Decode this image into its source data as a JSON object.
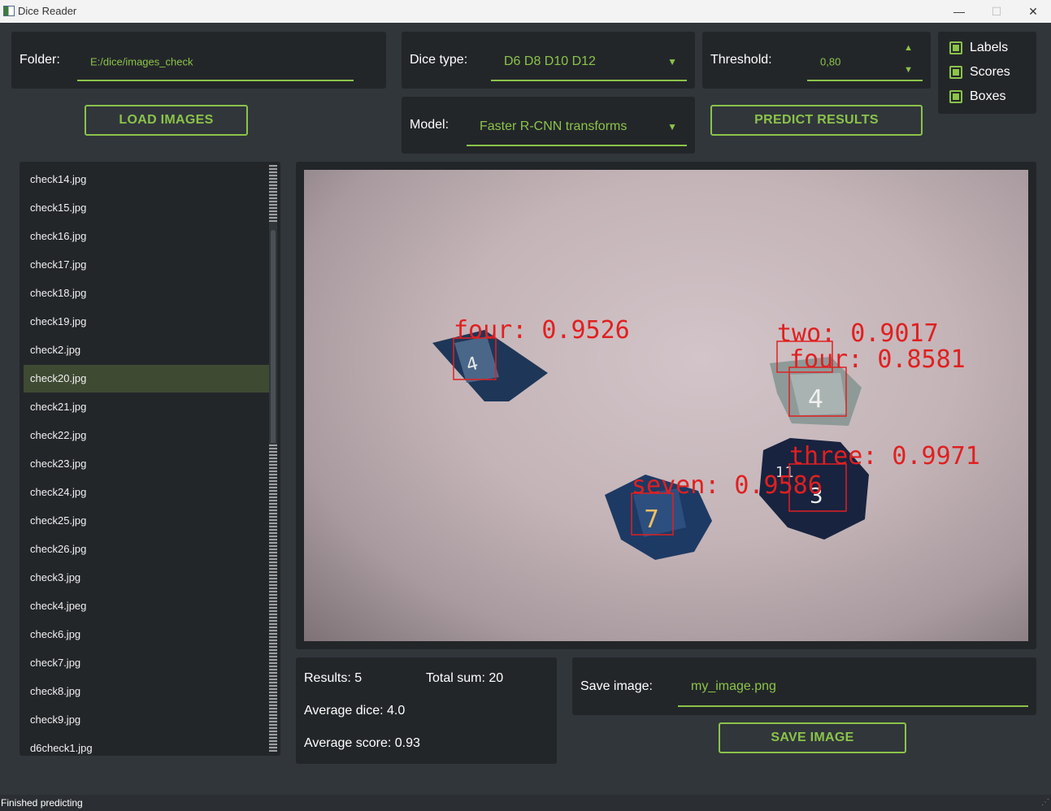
{
  "window": {
    "title": "Dice Reader",
    "minimize": "—",
    "maximize": "☐",
    "close": "✕"
  },
  "folder": {
    "label": "Folder:",
    "value": "E:/dice/images_check"
  },
  "dice_type": {
    "label": "Dice type:",
    "value": "D6 D8 D10 D12"
  },
  "threshold": {
    "label": "Threshold:",
    "value": "0,80"
  },
  "model": {
    "label": "Model:",
    "value": "Faster R-CNN transforms"
  },
  "buttons": {
    "load": "LOAD IMAGES",
    "predict": "PREDICT RESULTS",
    "save": "SAVE IMAGE"
  },
  "options": {
    "labels": "Labels",
    "scores": "Scores",
    "boxes": "Boxes"
  },
  "files": [
    "check14.jpg",
    "check15.jpg",
    "check16.jpg",
    "check17.jpg",
    "check18.jpg",
    "check19.jpg",
    "check2.jpg",
    "check20.jpg",
    "check21.jpg",
    "check22.jpg",
    "check23.jpg",
    "check24.jpg",
    "check25.jpg",
    "check26.jpg",
    "check3.jpg",
    "check4.jpeg",
    "check6.jpg",
    "check7.jpg",
    "check8.jpg",
    "check9.jpg",
    "d6check1.jpg"
  ],
  "selected_file": "check20.jpg",
  "detections": [
    {
      "label": "four: 0.9526"
    },
    {
      "label": "two: 0.9017"
    },
    {
      "label": "four: 0.8581"
    },
    {
      "label": "three: 0.9971"
    },
    {
      "label": "seven: 0.9586"
    }
  ],
  "results": {
    "count": "Results: 5",
    "total": "Total sum: 20",
    "average_dice": "Average dice: 4.0",
    "average_score": "Average score: 0.93"
  },
  "save": {
    "label": "Save image:",
    "value": "my_image.png"
  },
  "status_bar": "Finished predicting",
  "colors": {
    "accent": "#8bc34a",
    "panel": "#232629",
    "background": "#31363b",
    "box": "#e02020"
  }
}
